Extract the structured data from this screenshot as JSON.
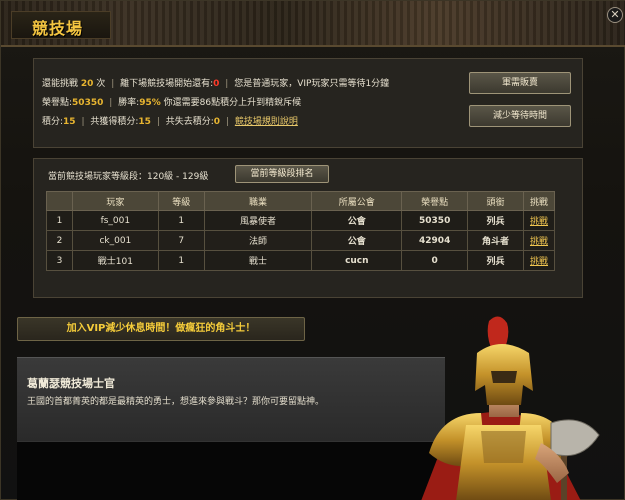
{
  "window": {
    "title": "競技場",
    "close_glyph": "✕"
  },
  "info": {
    "line1": {
      "remaining_label": "還能挑戰",
      "remaining_value": "20",
      "remaining_unit": "次",
      "next_label": "離下場競技場開始還有:",
      "next_value": "0",
      "vip_note": "您是普通玩家，VIP玩家只需等待1分鐘"
    },
    "line2": {
      "honor_label": "榮譽點:",
      "honor_value": "50350",
      "winrate_label": "勝率:",
      "winrate_value": "95%",
      "need_text": "你還需要86點積分上升到精銳斥候"
    },
    "line3": {
      "points_label": "積分:",
      "points_value": "15",
      "gained_label": "共獲得積分:",
      "gained_value": "15",
      "lost_label": "共失去積分:",
      "lost_value": "0",
      "rules_link": "競技場規則說明"
    }
  },
  "buttons": {
    "shop": "軍需販賣",
    "reduce_wait": "減少等待時間",
    "rank": "當前等級段排名"
  },
  "bracket": {
    "label": "當前競技場玩家等級段：120級 - 129級"
  },
  "table": {
    "headers": [
      "玩家",
      "等級",
      "職業",
      "所屬公會",
      "榮譽點",
      "頭銜",
      "挑戰"
    ],
    "rows": [
      {
        "rank": "1",
        "player": "fs_001",
        "level": "1",
        "class": "風暴使者",
        "guild": "公會",
        "honor": "50350",
        "title": "列兵",
        "challenge": "挑戰"
      },
      {
        "rank": "2",
        "player": "ck_001",
        "level": "7",
        "class": "法師",
        "guild": "公會",
        "honor": "42904",
        "title": "角斗者",
        "challenge": "挑戰"
      },
      {
        "rank": "3",
        "player": "戰士101",
        "level": "1",
        "class": "戰士",
        "guild": "cucn",
        "honor": "0",
        "title": "列兵",
        "challenge": "挑戰"
      }
    ]
  },
  "banner": {
    "text": "加入VIP減少休息時間！做瘋狂的角斗士！"
  },
  "npc": {
    "name": "葛蘭瑟競技場士官",
    "text": "王國的首都菁英的都是最精英的勇士，想進來參與戰斗？那你可要留點神。"
  },
  "colors": {
    "accent": "#f4c541",
    "highlight": "#e8b530",
    "alert": "#ff3a2a"
  }
}
